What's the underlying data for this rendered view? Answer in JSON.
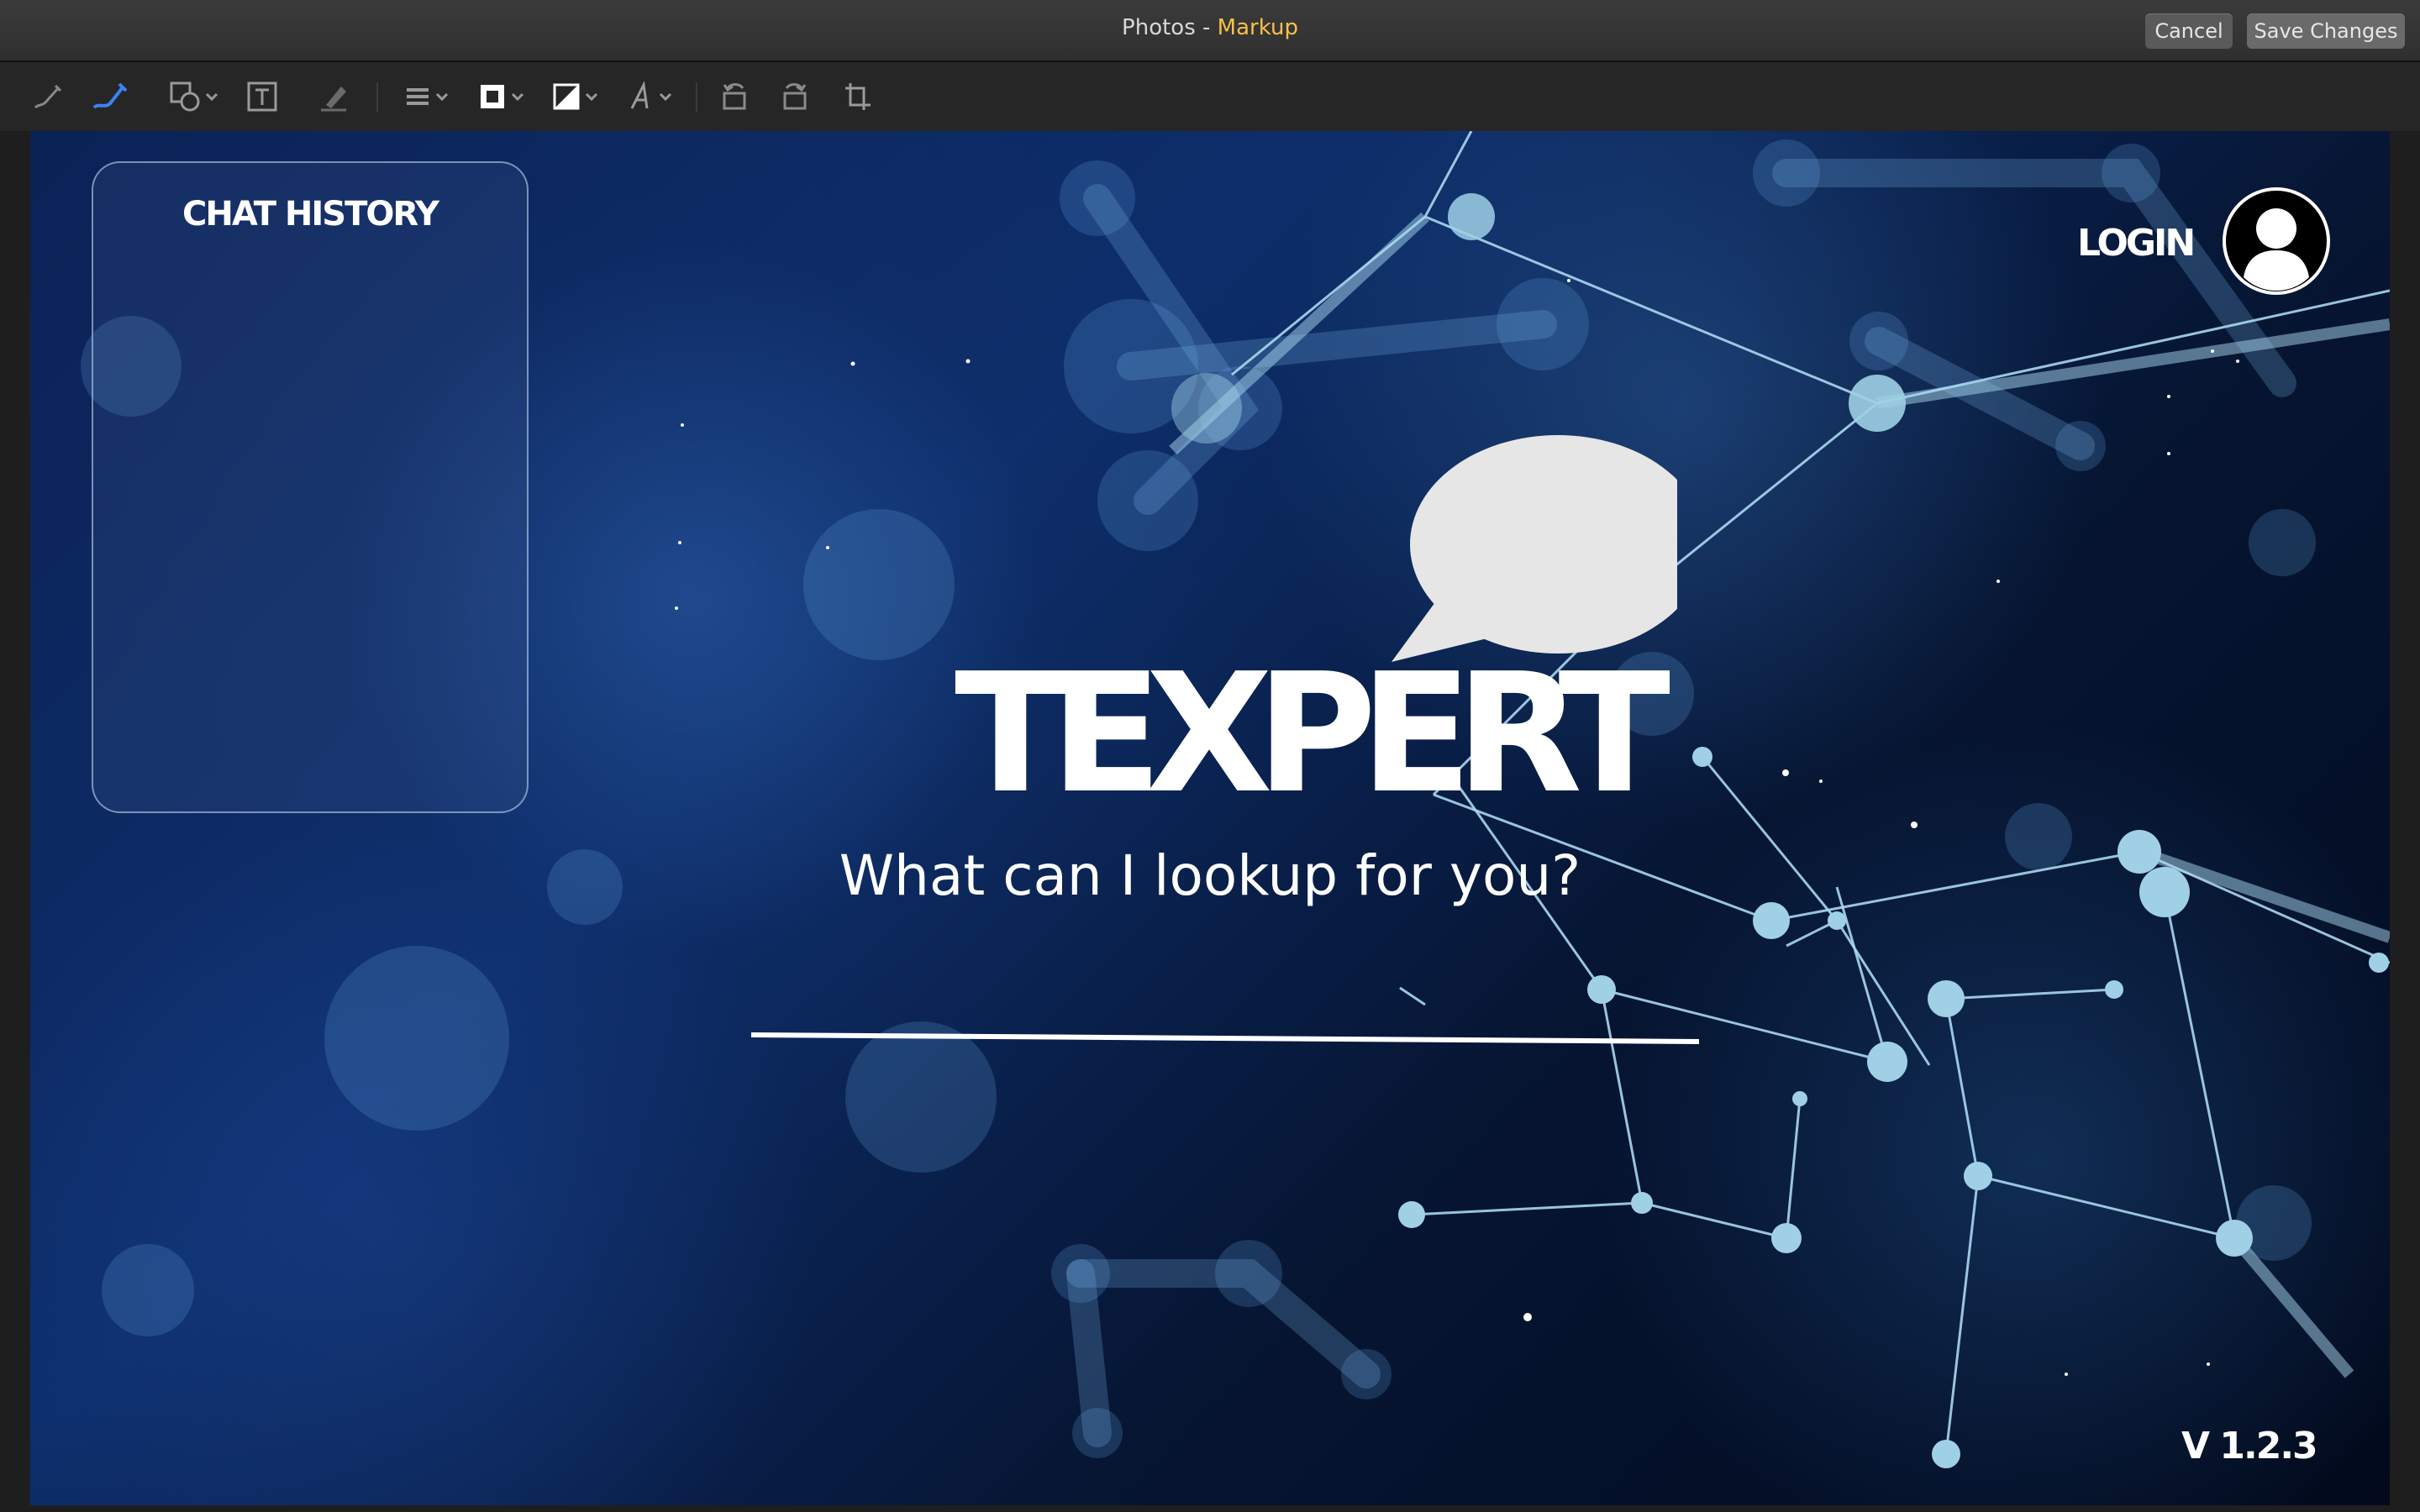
{
  "window": {
    "app_name": "Photos",
    "separator": " - ",
    "mode": "Markup",
    "accent_color": "#f5c14a"
  },
  "buttons": {
    "cancel": "Cancel",
    "save": "Save Changes"
  },
  "toolbar": {
    "tools": [
      "sketch-icon",
      "draw-icon",
      "shapes-icon",
      "text-icon",
      "highlight-icon",
      "line-style-icon",
      "border-color-icon",
      "fill-color-icon",
      "font-icon",
      "rotate-left-icon",
      "rotate-right-icon",
      "crop-icon"
    ],
    "active_tool": "draw-icon"
  },
  "image": {
    "chat_history_title": "CHAT HISTORY",
    "login_label": "LOGIN",
    "logo_text": "TEXPERT",
    "prompt": "What can I lookup for you?",
    "version": "V 1.2.3"
  }
}
